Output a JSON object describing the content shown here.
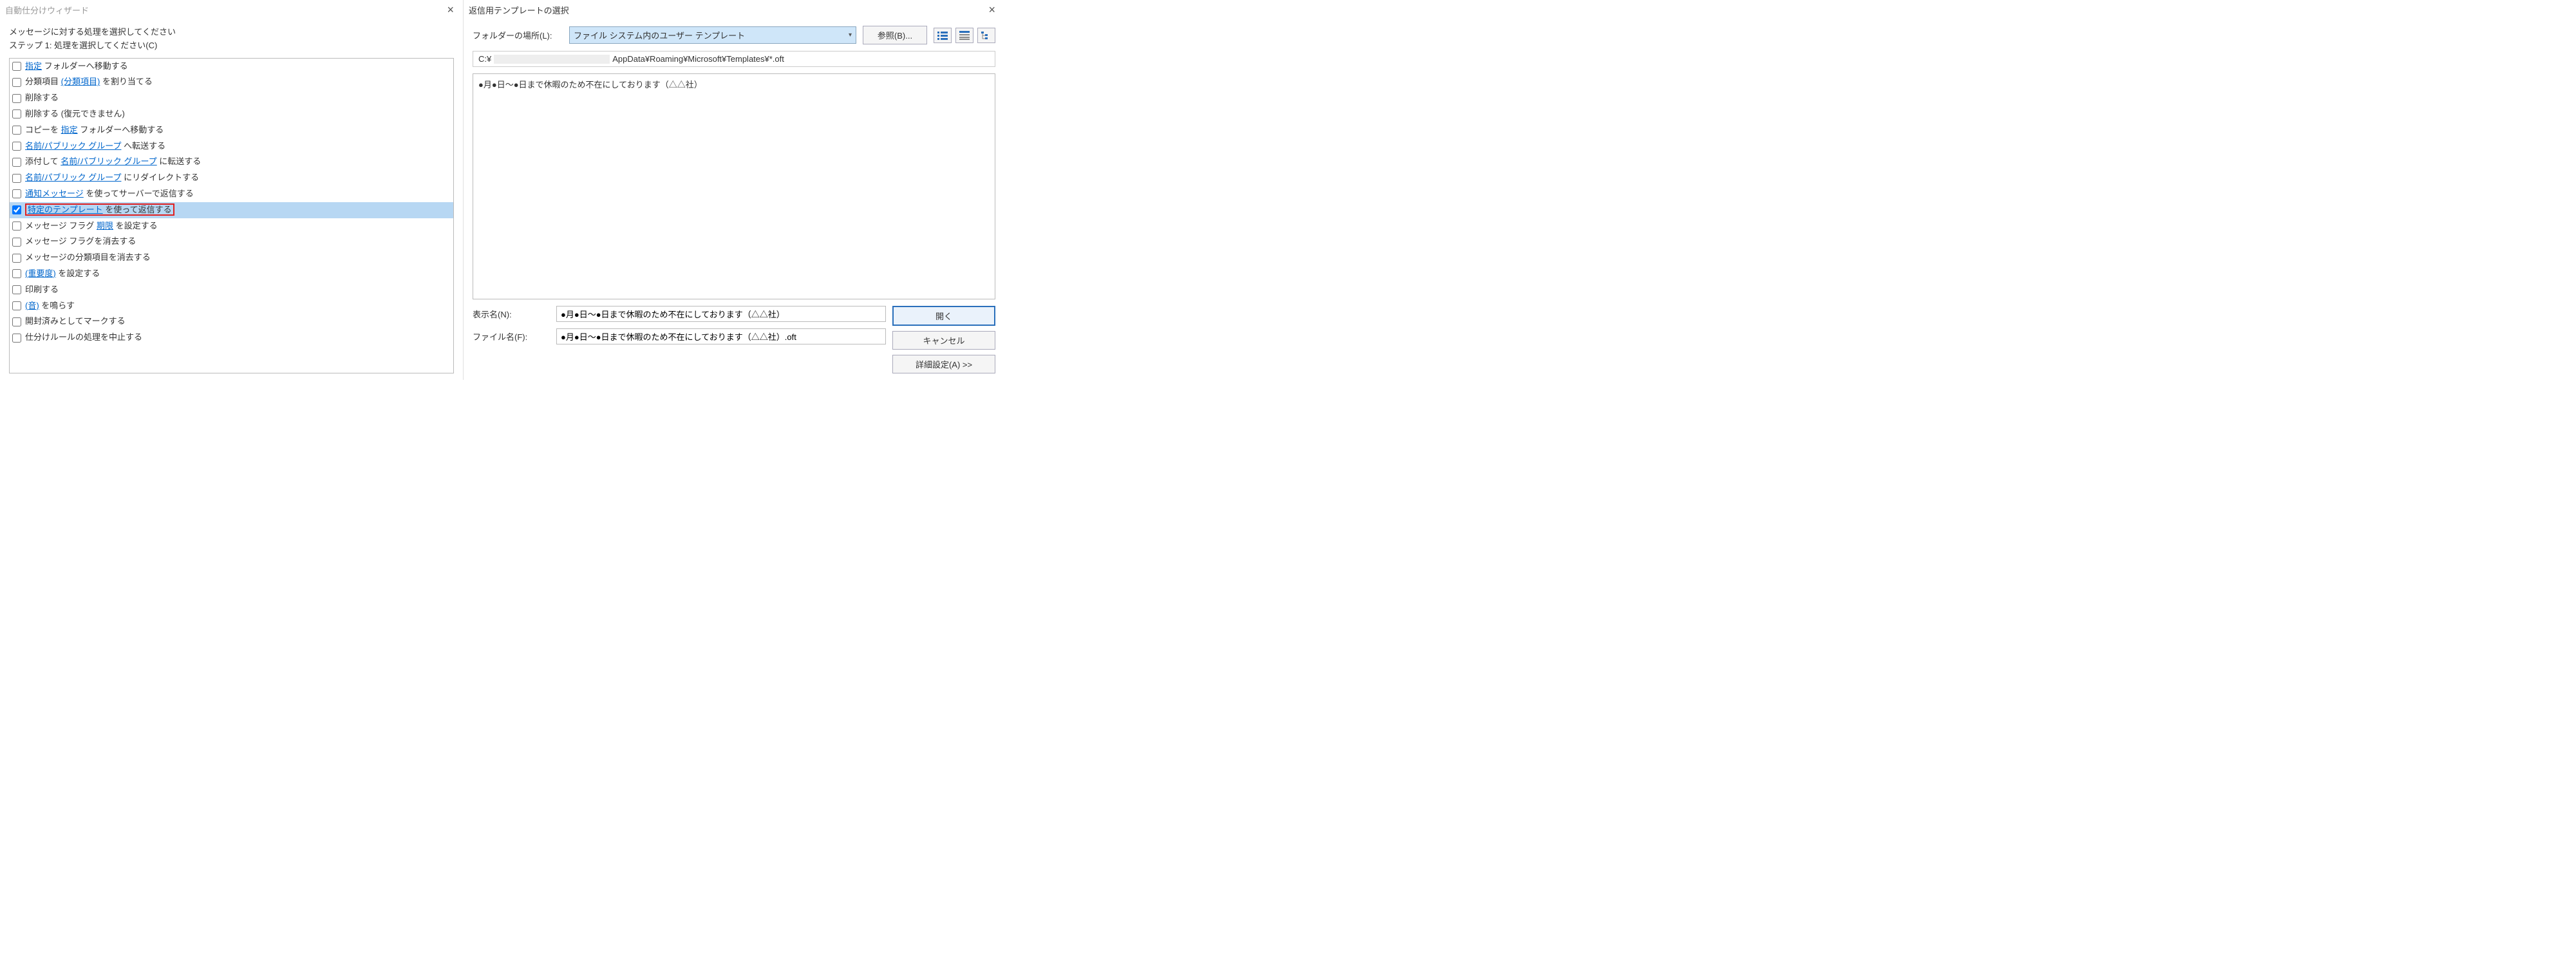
{
  "left": {
    "title": "自動仕分けウィザード",
    "instr1": "メッセージに対する処理を選択してください",
    "instr2": "ステップ 1: 処理を選択してください(C)",
    "rows": [
      {
        "pre": "",
        "link": "指定",
        "post": " フォルダーへ移動する",
        "checked": false,
        "sel": false
      },
      {
        "pre": "分類項目 ",
        "link": "(分類項目)",
        "post": " を割り当てる",
        "checked": false,
        "sel": false
      },
      {
        "pre": "削除する",
        "link": "",
        "post": "",
        "checked": false,
        "sel": false
      },
      {
        "pre": "削除する (復元できません)",
        "link": "",
        "post": "",
        "checked": false,
        "sel": false
      },
      {
        "pre": "コピーを ",
        "link": "指定",
        "post": " フォルダーへ移動する",
        "checked": false,
        "sel": false
      },
      {
        "pre": "",
        "link": "名前/パブリック グループ",
        "post": " へ転送する",
        "checked": false,
        "sel": false
      },
      {
        "pre": "添付して ",
        "link": "名前/パブリック グループ",
        "post": " に転送する",
        "checked": false,
        "sel": false
      },
      {
        "pre": "",
        "link": "名前/パブリック グループ",
        "post": " にリダイレクトする",
        "checked": false,
        "sel": false
      },
      {
        "pre": "",
        "link": "通知メッセージ",
        "post": " を使ってサーバーで返信する",
        "checked": false,
        "sel": false
      },
      {
        "pre": "",
        "link": "特定のテンプレート",
        "post": " を使って返信する",
        "checked": true,
        "sel": true,
        "red": true
      },
      {
        "pre": "メッセージ フラグ ",
        "link": "期限",
        "post": " を設定する",
        "checked": false,
        "sel": false
      },
      {
        "pre": "メッセージ フラグを消去する",
        "link": "",
        "post": "",
        "checked": false,
        "sel": false
      },
      {
        "pre": "メッセージの分類項目を消去する",
        "link": "",
        "post": "",
        "checked": false,
        "sel": false
      },
      {
        "pre": "",
        "link": "(重要度)",
        "post": " を設定する",
        "checked": false,
        "sel": false
      },
      {
        "pre": "印刷する",
        "link": "",
        "post": "",
        "checked": false,
        "sel": false
      },
      {
        "pre": "",
        "link": "(音)",
        "post": " を鳴らす",
        "checked": false,
        "sel": false
      },
      {
        "pre": "開封済みとしてマークする",
        "link": "",
        "post": "",
        "checked": false,
        "sel": false
      },
      {
        "pre": "仕分けルールの処理を中止する",
        "link": "",
        "post": "",
        "checked": false,
        "sel": false
      }
    ]
  },
  "right": {
    "title": "返信用テンプレートの選択",
    "folderLabel": "フォルダーの場所(L):",
    "folderValue": "ファイル システム内のユーザー テンプレート",
    "browseBtn": "参照(B)...",
    "pathPrefix": "C:¥",
    "pathSuffix": "AppData¥Roaming¥Microsoft¥Templates¥*.oft",
    "listItem": "●月●日～●日まで休暇のため不在にしております（△△社）",
    "displayNameLabel": "表示名(N):",
    "displayNameValue": "●月●日～●日まで休暇のため不在にしております（△△社）",
    "fileNameLabel": "ファイル名(F):",
    "fileNameValue": "●月●日～●日まで休暇のため不在にしております（△△社）.oft",
    "openBtn": "開く",
    "cancelBtn": "キャンセル",
    "advancedBtn": "詳細設定(A) >>"
  }
}
